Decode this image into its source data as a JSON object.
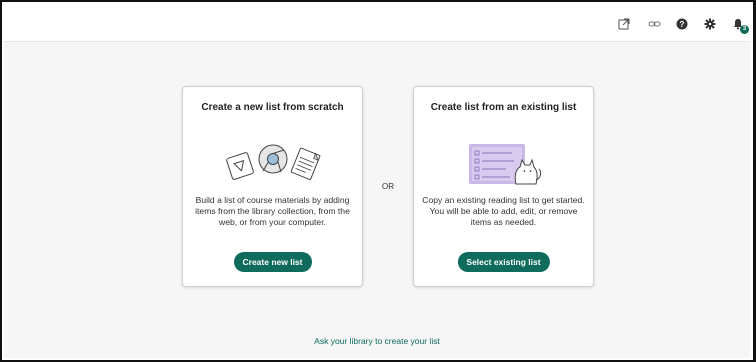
{
  "toolbar": {
    "icons": [
      "external-link-icon",
      "link-icon",
      "help-icon",
      "gear-icon",
      "notifications-icon"
    ],
    "notification_count": "3"
  },
  "cards": {
    "scratch": {
      "title": "Create a new list from scratch",
      "description": "Build a list of course materials by adding items from the library collection, from the web, or from your computer.",
      "button_label": "Create new list"
    },
    "existing": {
      "title": "Create list from an existing list",
      "description": "Copy an existing reading list to get started. You will be able to add, edit, or remove items as needed.",
      "button_label": "Select existing list"
    }
  },
  "or_label": "OR",
  "ask_library_link": "Ask your library to create your list",
  "colors": {
    "accent": "#0f6b5c",
    "background": "#f6f6f6",
    "illustration_purple": "#c9b8e6"
  }
}
